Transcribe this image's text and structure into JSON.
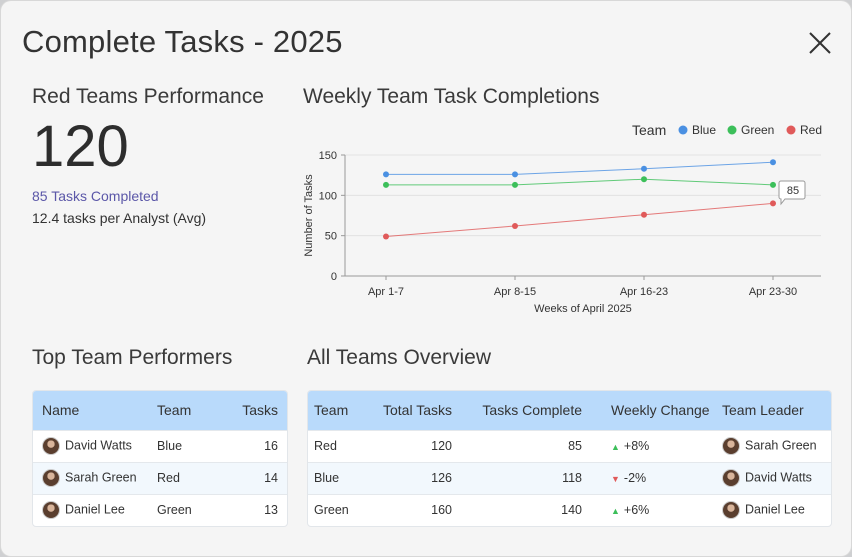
{
  "dialog": {
    "title": "Complete Tasks - 2025"
  },
  "kpi": {
    "heading": "Red Teams Performance",
    "value": "120",
    "completed": "85 Tasks Completed",
    "average": "12.4 tasks per Analyst (Avg)"
  },
  "chart_data": {
    "type": "line",
    "title": "Weekly Team Task Completions",
    "xlabel": "Weeks of April 2025",
    "ylabel": "Number of Tasks",
    "legend_title": "Team",
    "legend_position": "top-right",
    "categories": [
      "Apr 1-7",
      "Apr 8-15",
      "Apr 16-23",
      "Apr 23-30"
    ],
    "ylim": [
      0,
      150
    ],
    "yticks": [
      0,
      50,
      100,
      150
    ],
    "grid": true,
    "series": [
      {
        "name": "Blue",
        "color": "#4a90e2",
        "values": [
          126,
          126,
          133,
          141
        ]
      },
      {
        "name": "Green",
        "color": "#3cbf5a",
        "values": [
          113,
          113,
          120,
          113
        ]
      },
      {
        "name": "Red",
        "color": "#e05a5a",
        "values": [
          49,
          62,
          76,
          90
        ]
      }
    ],
    "tooltip": "85"
  },
  "top_performers": {
    "heading": "Top Team Performers",
    "columns": [
      "Name",
      "Team",
      "Tasks"
    ],
    "rows": [
      {
        "name": "David Watts",
        "team": "Blue",
        "tasks": "16"
      },
      {
        "name": "Sarah Green",
        "team": "Red",
        "tasks": "14"
      },
      {
        "name": "Daniel Lee",
        "team": "Green",
        "tasks": "13"
      }
    ]
  },
  "overview": {
    "heading": "All Teams Overview",
    "columns": [
      "Team",
      "Total Tasks",
      "Tasks Complete",
      "Weekly Change",
      "Team Leader"
    ],
    "rows": [
      {
        "team": "Red",
        "total": "120",
        "complete": "85",
        "change": "+8%",
        "dir": "up",
        "leader": "Sarah Green"
      },
      {
        "team": "Blue",
        "total": "126",
        "complete": "118",
        "change": "-2%",
        "dir": "down",
        "leader": "David Watts"
      },
      {
        "team": "Green",
        "total": "160",
        "complete": "140",
        "change": "+6%",
        "dir": "up",
        "leader": "Daniel Lee"
      }
    ]
  }
}
